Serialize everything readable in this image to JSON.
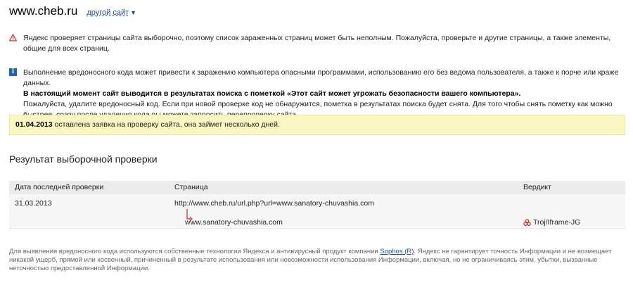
{
  "header": {
    "site": "www.cheb.ru",
    "other_site_label": "другой сайт",
    "other_site_icon": "chevron-down-icon"
  },
  "notices": {
    "partial_warning": "Яндекс проверяет страницы сайта выборочно, поэтому список зараженных страниц может быть неполным. Пожалуйста, проверьте и другие страницы, а также элементы, общие для всех страниц.",
    "malware_info_line1": "Выполнение вредоносного кода может привести к заражению компьютера опасными программами, использованию его без ведома пользователя, а также к порче или краже данных.",
    "malware_info_bold": "В настоящий момент сайт выводится в результатах поиска с пометкой «Этот сайт может угрожать безопасности вашего компьютера».",
    "malware_info_line3": "Пожалуйста, удалите вредоносный код. Если при новой проверке код не обнаружится, пометка в результатах поиска будет снята. Для того чтобы снять пометку как можно быстрее, сразу после удаления кода вы можете запросить перепроверку сайта."
  },
  "request": {
    "date": "01.04.2013",
    "text": "оставлена заявка на проверку сайта, она займет несколько дней."
  },
  "result": {
    "title": "Результат выборочной проверки",
    "columns": [
      "Дата последней проверки",
      "Страница",
      "Вердикт"
    ],
    "rows": [
      {
        "date": "31.03.2013",
        "page": "http://www.cheb.ru/url.php?url=www.sanatory-chuvashia.com",
        "redirect": "www.sanatory-chuvashia.com",
        "verdict": "Troj/Iframe-JG"
      }
    ]
  },
  "footer": {
    "text_before": "Для выявления вредоносного кода используются собственные технологии Яндекса и антивирусный продукт компании",
    "link": "Sophos (R)",
    "text_after": ". Яндекс не гарантирует точность Информации и не возмещает никакой ущерб, прямой или косвенный, причиненный в результате использования или невозможности использования Информации, включая, но не ограничиваясь этим, убытки, вызванные неточностью предоставленной Информации."
  },
  "colors": {
    "link": "#1a4fa3",
    "warning_red": "#d21f1f",
    "info_blue": "#1a66b5",
    "yellow_bg": "#fbf7c2",
    "redirect_arrow": "#e0241d"
  }
}
